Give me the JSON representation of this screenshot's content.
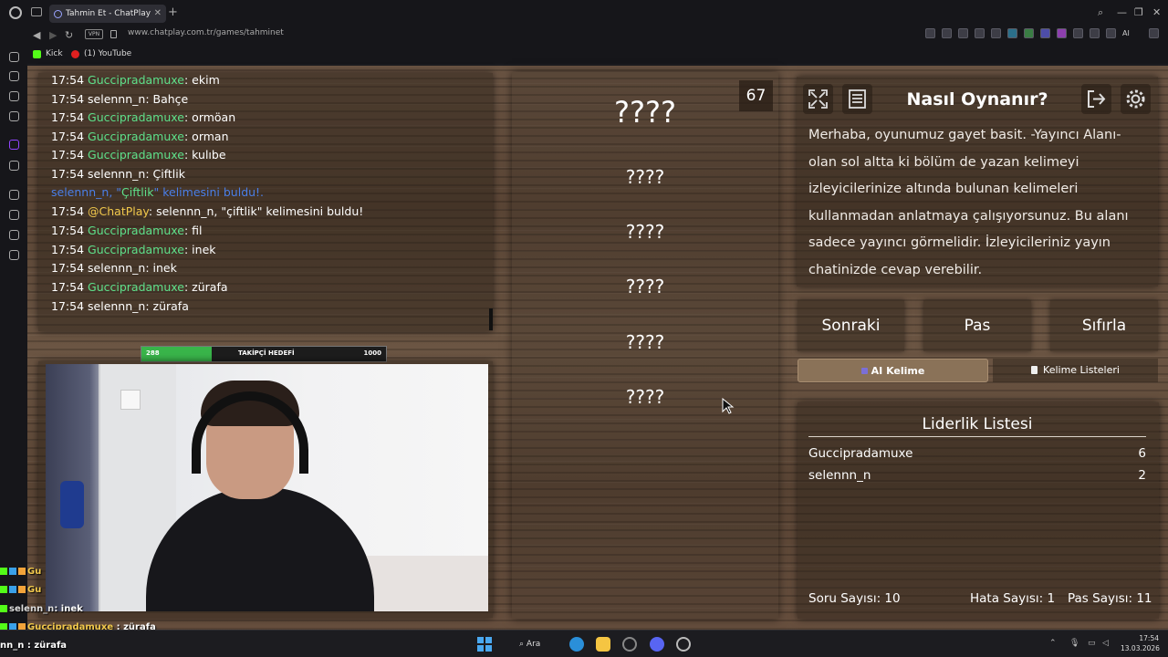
{
  "browser": {
    "tab_title": "Tahmin Et - ChatPlay",
    "url": "www.chatplay.com.tr/games/tahminet",
    "vpn_label": "VPN",
    "ai_ext_label": "AI",
    "bookmarks": [
      "Kick",
      "(1) YouTube"
    ]
  },
  "chat": {
    "lines": [
      {
        "time": "17:54",
        "user": "Guccipradamuxe",
        "user_color": "green",
        "msg": ": ekim"
      },
      {
        "time": "17:54",
        "user": "selennn_n",
        "user_color": "white",
        "msg": ": Bahçe"
      },
      {
        "time": "17:54",
        "user": "Guccipradamuxe",
        "user_color": "green",
        "msg": ": ormöan"
      },
      {
        "time": "17:54",
        "user": "Guccipradamuxe",
        "user_color": "green",
        "msg": ": orman"
      },
      {
        "time": "17:54",
        "user": "Guccipradamuxe",
        "user_color": "green",
        "msg": ": kulıbe"
      },
      {
        "time": "17:54",
        "user": "selennn_n",
        "user_color": "white",
        "msg": ": Çiftlik"
      }
    ],
    "system_found": {
      "user": "selennn_n",
      "word": "Çiftlik",
      "text_prefix": ", \"",
      "text_suffix": "\" kelimesini buldu!."
    },
    "bot_line": {
      "time": "17:54",
      "user": "@ChatPlay",
      "msg": ": selennn_n, \"çiftlik\" kelimesini buldu!"
    },
    "lines_after": [
      {
        "time": "17:54",
        "user": "Guccipradamuxe",
        "user_color": "green",
        "msg": ": fil"
      },
      {
        "time": "17:54",
        "user": "Guccipradamuxe",
        "user_color": "green",
        "msg": ": inek"
      },
      {
        "time": "17:54",
        "user": "selennn_n",
        "user_color": "white",
        "msg": ": inek"
      },
      {
        "time": "17:54",
        "user": "Guccipradamuxe",
        "user_color": "green",
        "msg": ": zürafa"
      },
      {
        "time": "17:54",
        "user": "selennn_n",
        "user_color": "white",
        "msg": ": zürafa"
      }
    ]
  },
  "follower_goal": {
    "current": "288",
    "label": "TAKİPÇİ HEDEFİ",
    "target": "1000",
    "progress": 0.288
  },
  "game": {
    "timer": "67",
    "main_word": "????",
    "words": [
      "????",
      "????",
      "????",
      "????",
      "????"
    ]
  },
  "howto": {
    "title": "Nasıl Oynanır?",
    "text": "Merhaba, oyunumuz gayet basit. -Yayıncı Alanı- olan sol altta ki bölüm de yazan kelimeyi izleyicilerinize altında bulunan kelimeleri kullanmadan anlatmaya çalışıyorsunuz. Bu alanı sadece yayıncı görmelidir. İzleyicileriniz yayın chatinizde cevap verebilir."
  },
  "buttons": {
    "next": "Sonraki",
    "pass": "Pas",
    "reset": "Sıfırla"
  },
  "tabs": {
    "ai_word": "AI Kelime",
    "word_lists": "Kelime Listeleri"
  },
  "leaderboard": {
    "title": "Liderlik Listesi",
    "rows": [
      {
        "name": "Guccipradamuxe",
        "score": "6"
      },
      {
        "name": "selennn_n",
        "score": "2"
      }
    ]
  },
  "stats": {
    "questions": "Soru Sayısı: 10",
    "errors": "Hata Sayısı: 1",
    "passes": "Pas Sayısı: 11"
  },
  "overlay_chat": {
    "line1": "Gu",
    "line2": "Gu",
    "line3_user": "selenn_n",
    "line3_msg": ": inek",
    "line4_user": "Guccipradamuxe",
    "line4_msg": " : zürafa",
    "line5": "nn_n : zürafa"
  },
  "taskbar": {
    "search": "Ara",
    "time": "17:54",
    "date": "13.03.2026"
  },
  "colors": {
    "accent_green": "#5ee08a",
    "system_blue": "#4a7fe8",
    "goal_green": "#39b54a"
  }
}
